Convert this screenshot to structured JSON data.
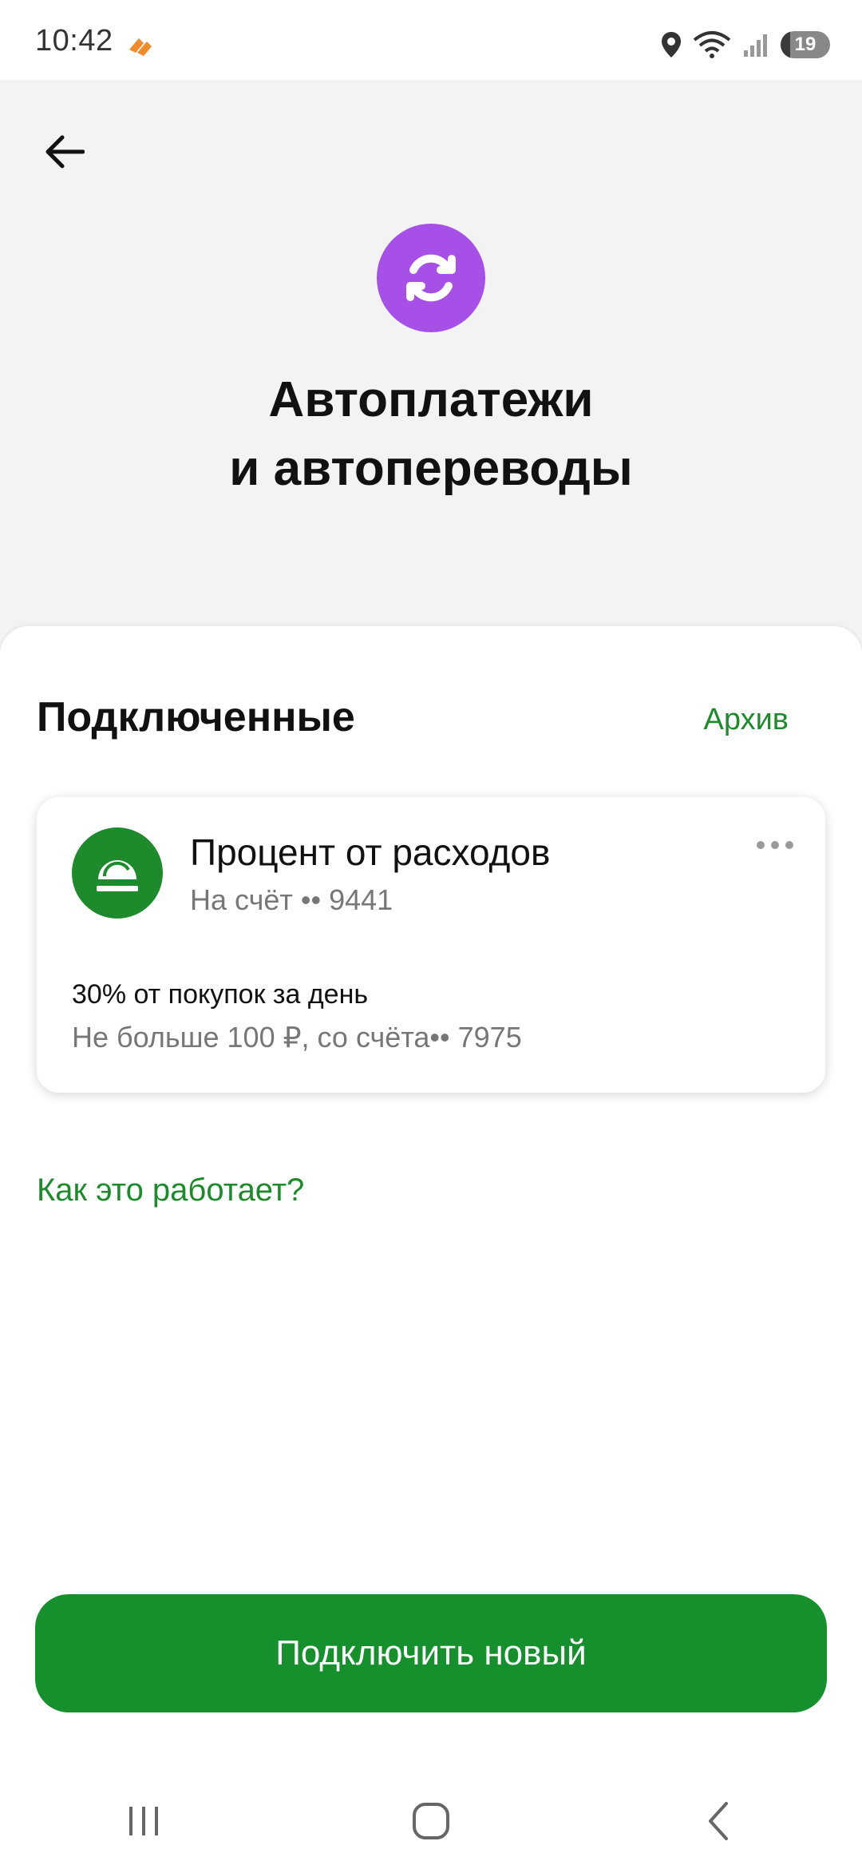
{
  "status_bar": {
    "time": "10:42",
    "battery": "19",
    "battery_level": 0.19
  },
  "header": {
    "title_line1": "Автоплатежи",
    "title_line2": "и автопереводы"
  },
  "section": {
    "title": "Подключенные",
    "archive_label": "Архив"
  },
  "autopayment": {
    "title": "Процент от расходов",
    "destination": "На счёт •• 9441",
    "rule": "30% от покупок за день",
    "limit": "Не больше 100 ₽, со счёта•• 7975",
    "icon": "piggy-dome-icon"
  },
  "help_link": "Как это работает?",
  "cta_label": "Подключить новый",
  "colors": {
    "accent_green": "#16902d",
    "hero_purple": "#a750e8",
    "header_bg": "#f3f3f3"
  }
}
